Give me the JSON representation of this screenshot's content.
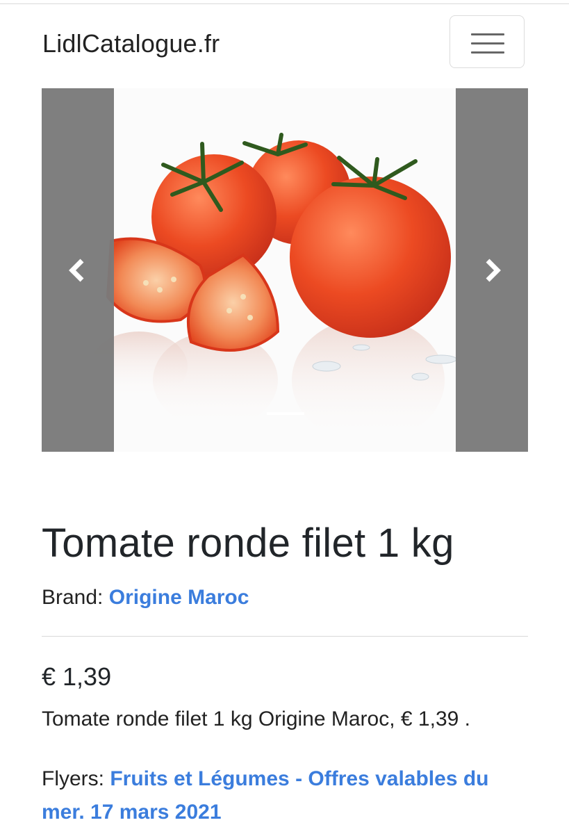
{
  "navbar": {
    "brand": "LidlCatalogue.fr",
    "menu_icon": "hamburger-menu-icon"
  },
  "carousel": {
    "image_alt": "Tomate ronde filet 1 kg",
    "prev_icon": "chevron-left-icon",
    "next_icon": "chevron-right-icon"
  },
  "product": {
    "title": "Tomate ronde filet 1 kg",
    "brand_label": "Brand:",
    "brand_value": "Origine Maroc",
    "price": "€ 1,39",
    "description": "Tomate ronde filet 1 kg Origine Maroc, € 1,39 .",
    "flyers_label": "Flyers:",
    "flyers_link": "Fruits et Légumes - Offres valables du mer. 17 mars 2021"
  },
  "colors": {
    "link": "#3b7ddd",
    "control_bg": "#7a7a7a",
    "tomato": "#e8401e"
  }
}
